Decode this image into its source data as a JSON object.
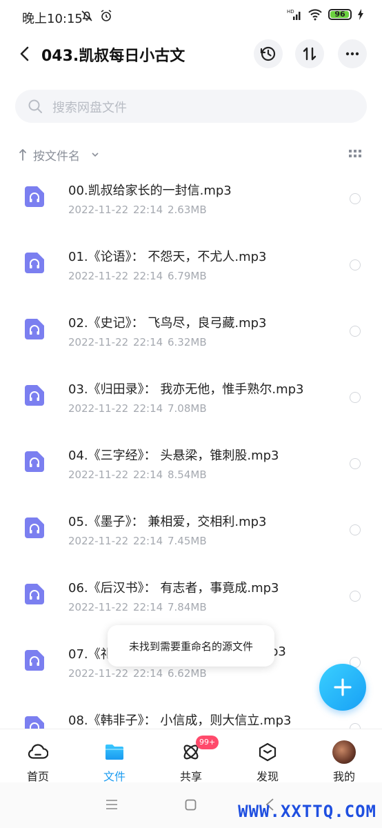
{
  "status_bar": {
    "time": "晚上10:15",
    "battery": "96"
  },
  "header": {
    "title": "043.凯叔每日小古文"
  },
  "search": {
    "placeholder": "搜索网盘文件"
  },
  "sort": {
    "label": "按文件名"
  },
  "files": [
    {
      "name": "00.凯叔给家长的一封信.mp3",
      "date": "2022-11-22",
      "time": "22:14",
      "size": "2.63MB"
    },
    {
      "name": "01.《论语》： 不怨天，不尤人.mp3",
      "date": "2022-11-22",
      "time": "22:14",
      "size": "6.79MB"
    },
    {
      "name": "02.《史记》： 飞鸟尽，良弓藏.mp3",
      "date": "2022-11-22",
      "time": "22:14",
      "size": "6.32MB"
    },
    {
      "name": "03.《归田录》： 我亦无他，惟手熟尔.mp3",
      "date": "2022-11-22",
      "time": "22:14",
      "size": "7.08MB"
    },
    {
      "name": "04.《三字经》： 头悬梁，锥刺股.mp3",
      "date": "2022-11-22",
      "time": "22:14",
      "size": "8.54MB"
    },
    {
      "name": "05.《墨子》： 兼相爱，交相利.mp3",
      "date": "2022-11-22",
      "time": "22:14",
      "size": "7.45MB"
    },
    {
      "name": "06.《后汉书》： 有志者，事竟成.mp3",
      "date": "2022-11-22",
      "time": "22:14",
      "size": "7.84MB"
    },
    {
      "name": "07.《礼",
      "name_tail": "p3",
      "date": "2022-11-22",
      "time": "22:14",
      "size": "6.62MB"
    },
    {
      "name": "08.《韩非子》： 小信成，则大信立.mp3",
      "date": "",
      "time": "",
      "size": ""
    }
  ],
  "toast": {
    "message": "未找到需要重命名的源文件"
  },
  "bottom_nav": [
    {
      "label": "首页",
      "icon": "cloud-icon"
    },
    {
      "label": "文件",
      "icon": "folder-icon",
      "active": true
    },
    {
      "label": "共享",
      "icon": "share-atom-icon",
      "badge": "99+"
    },
    {
      "label": "发现",
      "icon": "discover-icon"
    },
    {
      "label": "我的",
      "icon": "avatar"
    }
  ],
  "watermark": "WWW.XXTTQ.COM",
  "colors": {
    "accent": "#1a9bf0",
    "file_icon": "#7b7ff0",
    "badge": "#ff4a6b",
    "watermark": "#1f4fe0"
  }
}
